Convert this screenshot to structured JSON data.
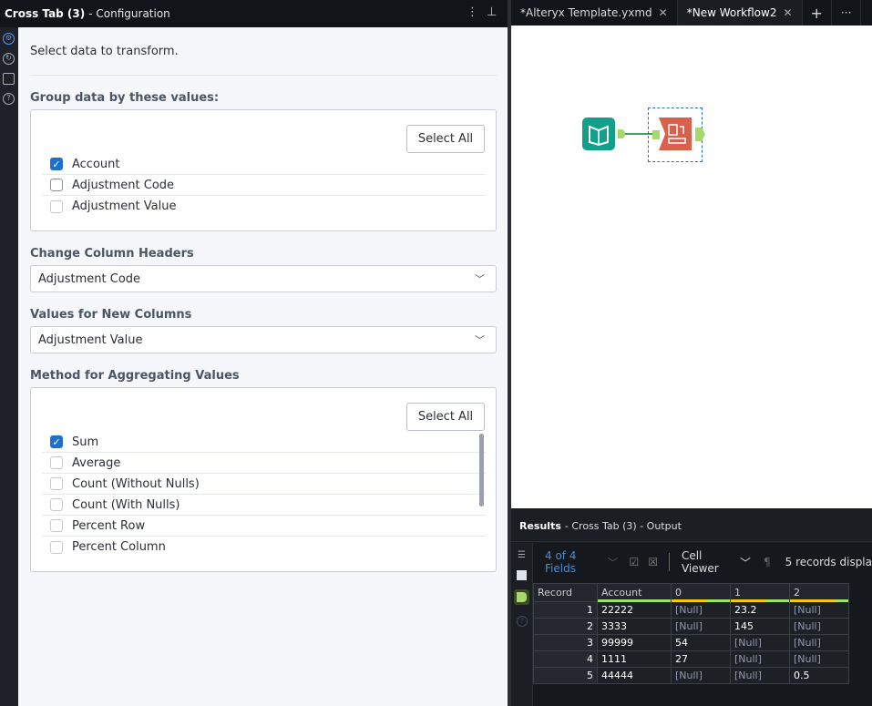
{
  "panel": {
    "title": "Cross Tab (3)",
    "subtitle": "- Configuration"
  },
  "config": {
    "intro": "Select data to transform.",
    "group_label": "Group data by these values:",
    "select_all": "Select All",
    "group_fields": [
      {
        "label": "Account",
        "checked": true
      },
      {
        "label": "Adjustment Code",
        "checked": false
      },
      {
        "label": "Adjustment Value",
        "checked": false
      }
    ],
    "headers_label": "Change Column Headers",
    "headers_value": "Adjustment Code",
    "values_label": "Values for New Columns",
    "values_value": "Adjustment Value",
    "method_label": "Method for Aggregating Values",
    "methods": [
      {
        "label": "Sum",
        "checked": true
      },
      {
        "label": "Average",
        "checked": false
      },
      {
        "label": "Count (Without Nulls)",
        "checked": false
      },
      {
        "label": "Count (With Nulls)",
        "checked": false
      },
      {
        "label": "Percent Row",
        "checked": false
      },
      {
        "label": "Percent Column",
        "checked": false
      }
    ]
  },
  "tabs": [
    {
      "label": "*Alteryx Template.yxmd"
    },
    {
      "label": "*New Workflow2"
    }
  ],
  "results": {
    "title": "Results",
    "subtitle": "- Cross Tab (3) - Output",
    "fields": "4 of 4 Fields",
    "viewer": "Cell Viewer",
    "records": "5 records displa",
    "columns": [
      "Record",
      "Account",
      "0",
      "1",
      "2"
    ],
    "rows": [
      [
        "1",
        "22222",
        "[Null]",
        "23.2",
        "[Null]"
      ],
      [
        "2",
        "3333",
        "[Null]",
        "145",
        "[Null]"
      ],
      [
        "3",
        "99999",
        "54",
        "[Null]",
        "[Null]"
      ],
      [
        "4",
        "1111",
        "27",
        "[Null]",
        "[Null]"
      ],
      [
        "5",
        "44444",
        "[Null]",
        "[Null]",
        "0.5"
      ]
    ]
  }
}
